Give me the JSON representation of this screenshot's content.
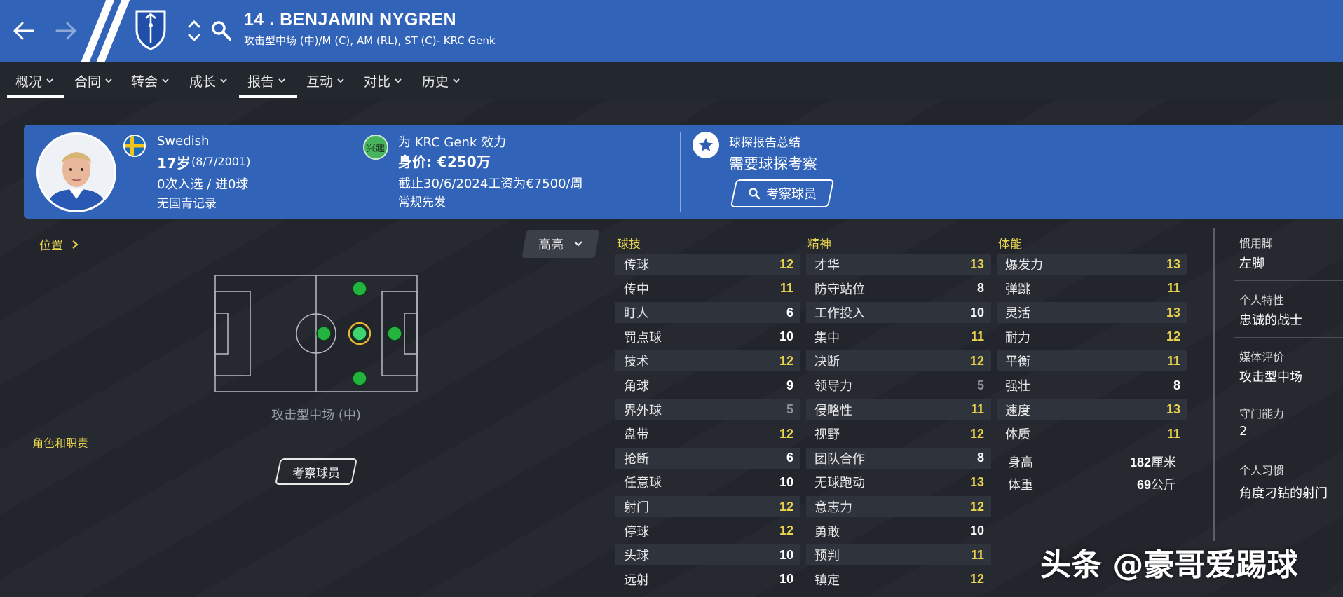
{
  "header": {
    "title": "14 . BENJAMIN NYGREN",
    "subtitle": "攻击型中场 (中)/M (C), AM (RL), ST (C)- KRC Genk"
  },
  "tabs": [
    {
      "label": "概况",
      "active": true
    },
    {
      "label": "合同"
    },
    {
      "label": "转会"
    },
    {
      "label": "成长"
    },
    {
      "label": "报告",
      "active": true
    },
    {
      "label": "互动"
    },
    {
      "label": "对比"
    },
    {
      "label": "历史"
    }
  ],
  "info": {
    "nationality": "Swedish",
    "age": "17岁",
    "dob": "(8/7/2001)",
    "caps": "0次入选 / 进0球",
    "youth": "无国青记录",
    "interest_badge": "兴趣",
    "club_line": "为 KRC Genk 效力",
    "value_prefix": "身价: ",
    "value": "€250万",
    "contract": "截止30/6/2024工资为€7500/周",
    "status": "常规先发",
    "scout_title": "球探报告总结",
    "scout_need": "需要球探考察",
    "scout_button": "考察球员"
  },
  "left": {
    "position_label": "位置",
    "highlight_label": "高亮",
    "pitch_caption": "攻击型中场 (中)",
    "roles_label": "角色和职责",
    "scout_button": "考察球员"
  },
  "attributes": {
    "technical_title": "球技",
    "mental_title": "精神",
    "physical_title": "体能",
    "technical": [
      {
        "name": "传球",
        "value": "12",
        "tone": "yellow"
      },
      {
        "name": "传中",
        "value": "11",
        "tone": "yellow"
      },
      {
        "name": "盯人",
        "value": "6",
        "tone": "white"
      },
      {
        "name": "罚点球",
        "value": "10",
        "tone": "white"
      },
      {
        "name": "技术",
        "value": "12",
        "tone": "yellow"
      },
      {
        "name": "角球",
        "value": "9",
        "tone": "white"
      },
      {
        "name": "界外球",
        "value": "5",
        "tone": "grey"
      },
      {
        "name": "盘带",
        "value": "12",
        "tone": "yellow"
      },
      {
        "name": "抢断",
        "value": "6",
        "tone": "white"
      },
      {
        "name": "任意球",
        "value": "10",
        "tone": "white"
      },
      {
        "name": "射门",
        "value": "12",
        "tone": "yellow"
      },
      {
        "name": "停球",
        "value": "12",
        "tone": "yellow"
      },
      {
        "name": "头球",
        "value": "10",
        "tone": "white"
      },
      {
        "name": "远射",
        "value": "10",
        "tone": "white"
      }
    ],
    "mental": [
      {
        "name": "才华",
        "value": "13",
        "tone": "yellow"
      },
      {
        "name": "防守站位",
        "value": "8",
        "tone": "white"
      },
      {
        "name": "工作投入",
        "value": "10",
        "tone": "white"
      },
      {
        "name": "集中",
        "value": "11",
        "tone": "yellow"
      },
      {
        "name": "决断",
        "value": "12",
        "tone": "yellow"
      },
      {
        "name": "领导力",
        "value": "5",
        "tone": "grey"
      },
      {
        "name": "侵略性",
        "value": "11",
        "tone": "yellow"
      },
      {
        "name": "视野",
        "value": "12",
        "tone": "yellow"
      },
      {
        "name": "团队合作",
        "value": "8",
        "tone": "white"
      },
      {
        "name": "无球跑动",
        "value": "13",
        "tone": "yellow"
      },
      {
        "name": "意志力",
        "value": "12",
        "tone": "yellow"
      },
      {
        "name": "勇敢",
        "value": "10",
        "tone": "white"
      },
      {
        "name": "预判",
        "value": "11",
        "tone": "yellow"
      },
      {
        "name": "镇定",
        "value": "12",
        "tone": "yellow"
      }
    ],
    "physical": [
      {
        "name": "爆发力",
        "value": "13",
        "tone": "yellow"
      },
      {
        "name": "弹跳",
        "value": "11",
        "tone": "yellow"
      },
      {
        "name": "灵活",
        "value": "13",
        "tone": "yellow"
      },
      {
        "name": "耐力",
        "value": "12",
        "tone": "yellow"
      },
      {
        "name": "平衡",
        "value": "11",
        "tone": "yellow"
      },
      {
        "name": "强壮",
        "value": "8",
        "tone": "white"
      },
      {
        "name": "速度",
        "value": "13",
        "tone": "yellow"
      },
      {
        "name": "体质",
        "value": "11",
        "tone": "yellow"
      }
    ],
    "height_label": "身高",
    "height_num": "182",
    "height_unit": "厘米",
    "weight_label": "体重",
    "weight_num": "69",
    "weight_unit": "公斤"
  },
  "side": {
    "foot_label": "惯用脚",
    "foot_value": "左脚",
    "trait_label": "个人特性",
    "trait_value": "忠诚的战士",
    "media_label": "媒体评价",
    "media_value": "攻击型中场",
    "gk_label": "守门能力",
    "gk_value": "2",
    "habit_label": "个人习惯",
    "habit_value": "角度刁钻的射门"
  },
  "watermark": "头条 @豪哥爱踢球",
  "colors": {
    "header_blue": "#3163b8",
    "accent_yellow": "#e8d44d",
    "background": "#23272e"
  },
  "icons": [
    "back-arrow-icon",
    "forward-arrow-icon",
    "club-crest-icon",
    "up-down-icon",
    "search-icon",
    "chevron-down-icon",
    "chevron-right-icon",
    "sweden-flag-icon",
    "star-icon"
  ]
}
